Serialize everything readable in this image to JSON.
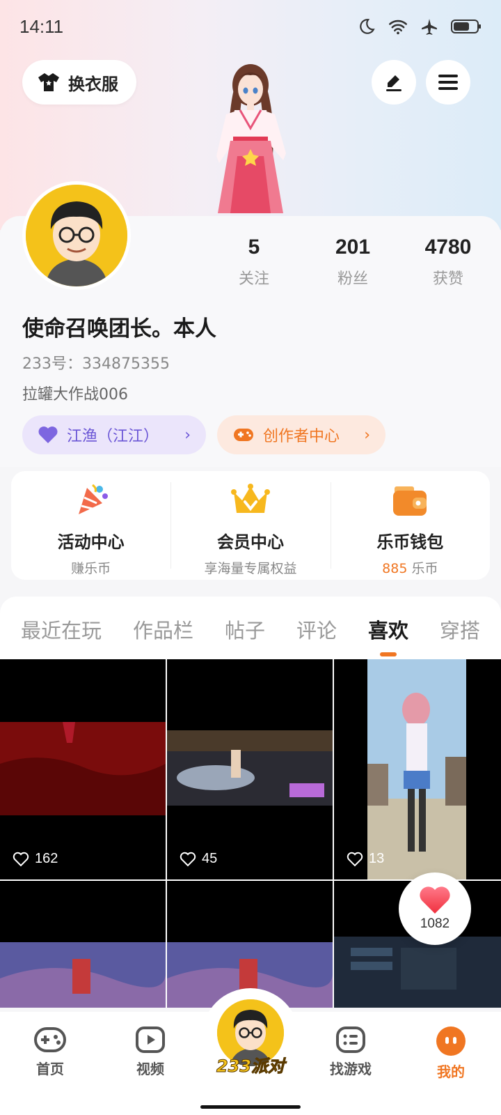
{
  "status_bar": {
    "time": "14:11"
  },
  "header": {
    "outfit_button_label": "换衣服"
  },
  "profile": {
    "username": "使命召唤团长。本人",
    "id_line": "233号：334875355",
    "bio": "拉罐大作战006",
    "stats": [
      {
        "value": "5",
        "label": "关注"
      },
      {
        "value": "201",
        "label": "粉丝"
      },
      {
        "value": "4780",
        "label": "获赞"
      }
    ],
    "guild_pill": "江渔（江江）",
    "creator_pill": "创作者中心"
  },
  "features": [
    {
      "title": "活动中心",
      "subtitle": "赚乐币"
    },
    {
      "title": "会员中心",
      "subtitle": "享海量专属权益"
    },
    {
      "title": "乐币钱包",
      "amount": "885",
      "unit": " 乐币"
    }
  ],
  "tabs": [
    "最近在玩",
    "作品栏",
    "帖子",
    "评论",
    "喜欢",
    "穿搭"
  ],
  "active_tab": "喜欢",
  "liked_posts": [
    {
      "likes": "162"
    },
    {
      "likes": "45"
    },
    {
      "likes": "13"
    }
  ],
  "floating_like": {
    "count": "1082"
  },
  "bottom_nav": {
    "items": [
      "首页",
      "视频",
      "找游戏",
      "我的"
    ],
    "center_brand": "233派对",
    "active": "我的"
  },
  "colors": {
    "accent": "#f07622",
    "guild": "#6a55d6",
    "vip_gold": "#f4c21a"
  }
}
